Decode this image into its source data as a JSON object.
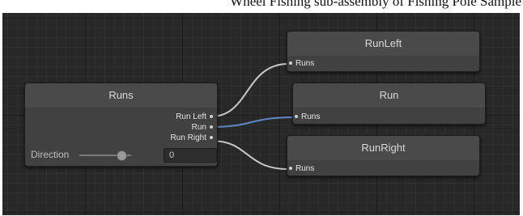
{
  "page": {
    "cropped_caption": "Wheel Fishing sub-assembly of Fishing Pole Sample"
  },
  "nodes": {
    "runs": {
      "title": "Runs",
      "outputs": [
        "Run Left",
        "Run",
        "Run Right"
      ],
      "parameter": {
        "label": "Direction",
        "value": "0",
        "slider_value": 0
      }
    },
    "run_left": {
      "title": "RunLeft",
      "input": "Runs"
    },
    "run": {
      "title": "Run",
      "input": "Runs"
    },
    "run_right": {
      "title": "RunRight",
      "input": "Runs"
    }
  },
  "colors": {
    "background": "#282828",
    "node_body": "#414141",
    "wire_default": "#c8c8c8",
    "wire_active": "#5a8ac6"
  }
}
